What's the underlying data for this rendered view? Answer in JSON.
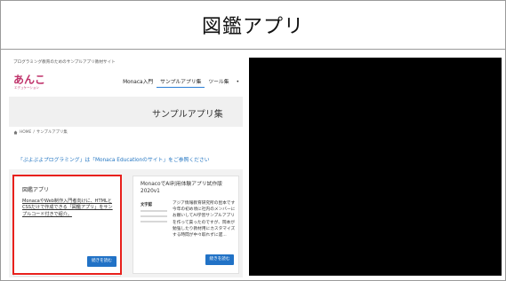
{
  "slide": {
    "title": "図鑑アプリ"
  },
  "site": {
    "tagline": "プログラミング教育のためのサンプルアプリ教材サイト",
    "logo": {
      "mark": "あんこ",
      "sub": "エデュケーション"
    },
    "nav": [
      {
        "label": "Monaca入門"
      },
      {
        "label": "サンプルアプリ集"
      },
      {
        "label": "ツール集"
      },
      {
        "label": "•"
      }
    ],
    "hero_title": "サンプルアプリ集",
    "breadcrumb": {
      "home": "HOME",
      "separator": "/",
      "current": "サンプルアプリ集"
    },
    "notice": "「ぷよぷよプログラミング」は「Monaca Educationのサイト」をご参照ください",
    "cards": [
      {
        "title": "図鑑アプリ",
        "description": "MonacaやWeb制作入門者向けに、HTMLとCSSだけで作成できる「図鑑アプリ」をサンプルコード付きで紹介。",
        "button": "続きを読む"
      },
      {
        "title": "MonacoでAI利用体験アプリ試作版2020v1",
        "thumb_title": "文字認",
        "description": "アジア情報教育研究所の昆本です　今年の初め頃に社内のメンバーにお願いしてAI学習サンプルアプリを作って貰ったのですが、岡本が勉強したり教材用にカスタマイズする時間が中々取れずに遅...",
        "button": "続きを読む"
      }
    ]
  },
  "colors": {
    "accent": "#2172c6",
    "highlight": "#e8201c",
    "logo": "#c0336b"
  }
}
